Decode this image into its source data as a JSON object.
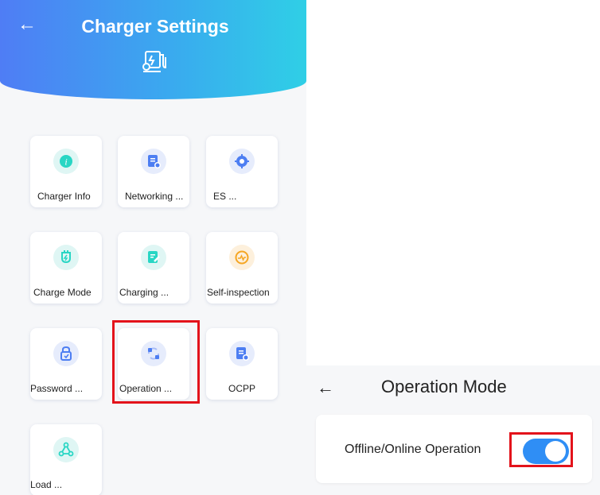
{
  "charger_settings": {
    "back_icon": "arrow-left-icon",
    "title": "Charger Settings",
    "header_icon": "charger-settings-icon",
    "tiles": [
      {
        "label": "Charger Info",
        "icon": "info-icon",
        "color": "#28d6c4"
      },
      {
        "label": "Networking ...",
        "icon": "document-settings-icon",
        "color": "#4d7ef2"
      },
      {
        "label": "ES ...",
        "icon": "gear-icon",
        "color": "#4d7ef2"
      },
      {
        "label": "Charge Mode",
        "icon": "plug-icon",
        "color": "#28d6c4"
      },
      {
        "label": "Charging ...",
        "icon": "document-edit-icon",
        "color": "#28d6c4"
      },
      {
        "label": "Self-inspection",
        "icon": "diagnostics-icon",
        "color": "#f5a623"
      },
      {
        "label": "Password ...",
        "icon": "lock-icon",
        "color": "#4d7ef2"
      },
      {
        "label": "Operation ...",
        "icon": "sync-icon",
        "color": "#4d7ef2"
      },
      {
        "label": "OCPP",
        "icon": "document-settings-icon",
        "color": "#4d7ef2"
      },
      {
        "label": "Load ...",
        "icon": "network-nodes-icon",
        "color": "#28d6c4"
      }
    ]
  },
  "operation_mode": {
    "back_icon": "arrow-left-icon",
    "title": "Operation Mode",
    "setting_label": "Offline/Online Operation",
    "toggle_state": "on"
  },
  "colors": {
    "header_gradient_start": "#4f7df5",
    "header_gradient_end": "#2fcfe6",
    "highlight": "#e3131b",
    "toggle_on": "#2f8ef5"
  }
}
